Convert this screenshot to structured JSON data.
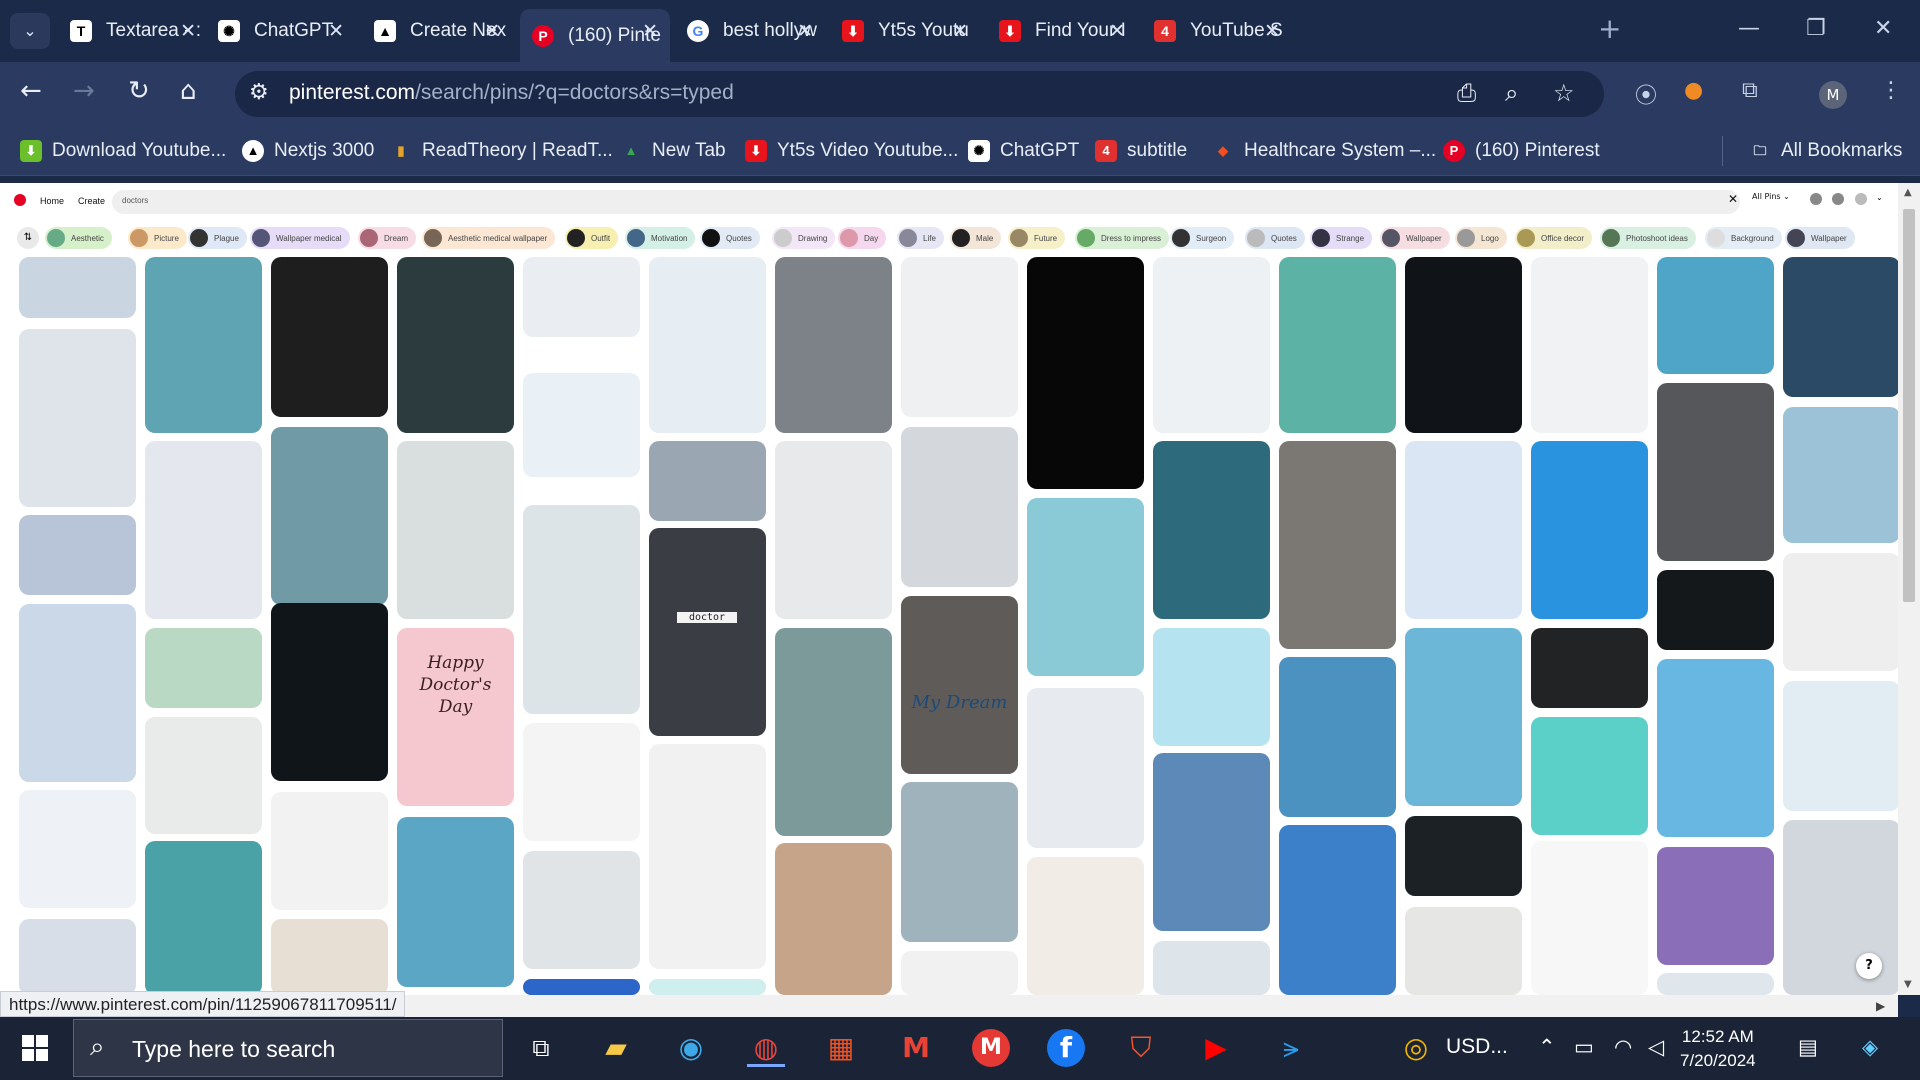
{
  "browser": {
    "tabs": [
      {
        "label": "Textarea - :",
        "favicon": "T",
        "color": "#000000"
      },
      {
        "label": "ChatGPT",
        "favicon": "✺",
        "color": "#ffffff"
      },
      {
        "label": "Create Nex",
        "favicon": "▲",
        "color": "#000000"
      },
      {
        "label": "(160) Pinte",
        "favicon": "P",
        "color": "#e60023"
      },
      {
        "label": "best hollyw",
        "favicon": "G",
        "color": "#ffffff"
      },
      {
        "label": "Yt5s Youtu",
        "favicon": "⬇",
        "color": "#e8141c"
      },
      {
        "label": "Find Your I",
        "favicon": "⬇",
        "color": "#e8141c"
      },
      {
        "label": "YouTube S",
        "favicon": "4",
        "color": "#e03030"
      }
    ],
    "url_host": "pinterest.com",
    "url_path": "/search/pins/?q=doctors&rs=typed",
    "profile_initial": "M",
    "bookmarks": [
      {
        "label": "Download Youtube...",
        "favicon": "⬇",
        "color": "#6abf2a"
      },
      {
        "label": "Nextjs 3000",
        "favicon": "▲",
        "color": "#000000"
      },
      {
        "label": "ReadTheory | ReadT...",
        "favicon": "▮",
        "color": "#e3a22a"
      },
      {
        "label": "New Tab",
        "favicon": "▲",
        "color": "#2b8a3e"
      },
      {
        "label": "Yt5s Video Youtube...",
        "favicon": "⬇",
        "color": "#e8141c"
      },
      {
        "label": "ChatGPT",
        "favicon": "✺",
        "color": "#ffffff"
      },
      {
        "label": "subtitle",
        "favicon": "4",
        "color": "#e03030"
      },
      {
        "label": "Healthcare System –...",
        "favicon": "◆",
        "color": "#f24e1e"
      },
      {
        "label": "(160) Pinterest",
        "favicon": "P",
        "color": "#e60023"
      }
    ],
    "all_bookmarks": "All Bookmarks",
    "status_url": "https://www.pinterest.com/pin/11259067811709511/"
  },
  "pinterest": {
    "nav": {
      "home": "Home",
      "create": "Create"
    },
    "search_value": "doctors",
    "filter_label": "All Pins",
    "chips": [
      {
        "label": "Aesthetic",
        "bg": "#d6f0c9"
      },
      {
        "label": "Picture",
        "bg": "#fce9c9"
      },
      {
        "label": "Plague",
        "bg": "#dfe8f7"
      },
      {
        "label": "Wallpaper medical",
        "bg": "#e7dcf7"
      },
      {
        "label": "Dream",
        "bg": "#f7dce5"
      },
      {
        "label": "Aesthetic medical wallpaper",
        "bg": "#fbe7d3"
      },
      {
        "label": "Outfit",
        "bg": "#f7efb0"
      },
      {
        "label": "Motivation",
        "bg": "#d4efe6"
      },
      {
        "label": "Quotes",
        "bg": "#e1eaf5"
      },
      {
        "label": "Drawing",
        "bg": "#f3e6f7"
      },
      {
        "label": "Day",
        "bg": "#f5d8ee"
      },
      {
        "label": "Life",
        "bg": "#e6e6f5"
      },
      {
        "label": "Male",
        "bg": "#f3e5d8"
      },
      {
        "label": "Future",
        "bg": "#f5f0c8"
      },
      {
        "label": "Dress to impress",
        "bg": "#d9f0d6"
      },
      {
        "label": "Surgeon",
        "bg": "#e2ecf6"
      },
      {
        "label": "Quotes",
        "bg": "#dde6f3"
      },
      {
        "label": "Strange",
        "bg": "#e5dcf7"
      },
      {
        "label": "Wallpaper",
        "bg": "#f5dde2"
      },
      {
        "label": "Logo",
        "bg": "#f5e6d4"
      },
      {
        "label": "Office decor",
        "bg": "#f1eec9"
      },
      {
        "label": "Photoshoot ideas",
        "bg": "#d8efe2"
      },
      {
        "label": "Background",
        "bg": "#e4ecf5"
      },
      {
        "label": "Wallpaper",
        "bg": "#dfe7f3"
      }
    ],
    "pin_text": {
      "happy_doctors_day": "Happy Doctor's Day",
      "my_dream": "My Dream",
      "doctor_note": "doctor"
    },
    "help": "?"
  },
  "taskbar": {
    "search_placeholder": "Type here to search",
    "weather": "USD...",
    "time": "12:52 AM",
    "date": "7/20/2024"
  }
}
